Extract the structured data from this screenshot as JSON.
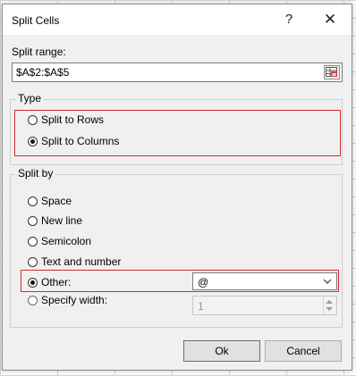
{
  "dialog": {
    "title": "Split Cells",
    "help_glyph": "?",
    "close_glyph": "✕"
  },
  "range": {
    "label": "Split range:",
    "value": "$A$2:$A$5",
    "picker_icon": "range-select-icon"
  },
  "type": {
    "title": "Type",
    "options": [
      {
        "label": "Split to Rows",
        "checked": false
      },
      {
        "label": "Split to Columns",
        "checked": true
      }
    ]
  },
  "split_by": {
    "title": "Split by",
    "options": [
      {
        "label": "Space",
        "checked": false
      },
      {
        "label": "New line",
        "checked": false
      },
      {
        "label": "Semicolon",
        "checked": false
      },
      {
        "label": "Text and number",
        "checked": false
      },
      {
        "label": "Other:",
        "checked": true
      },
      {
        "label": "Specify width:",
        "checked": false
      }
    ],
    "other_value": "@",
    "width_value": "1"
  },
  "buttons": {
    "ok": "Ok",
    "cancel": "Cancel"
  },
  "colors": {
    "highlight": "#d22a2a",
    "dialog_bg": "#f0f0f0"
  }
}
